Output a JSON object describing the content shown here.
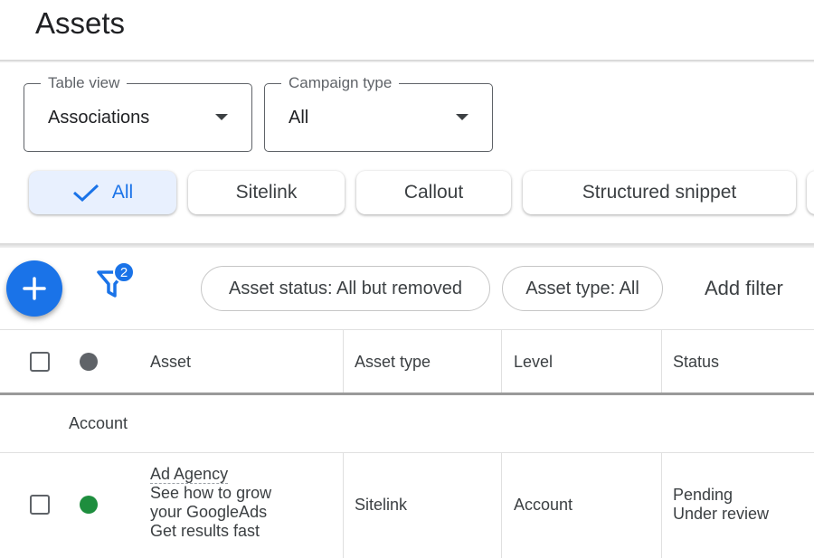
{
  "header": {
    "title": "Assets"
  },
  "filters": {
    "table_view": {
      "label": "Table view",
      "value": "Associations"
    },
    "campaign_type": {
      "label": "Campaign type",
      "value": "All"
    }
  },
  "chips": [
    {
      "label": "All",
      "selected": true
    },
    {
      "label": "Sitelink"
    },
    {
      "label": "Callout"
    },
    {
      "label": "Structured snippet"
    }
  ],
  "toolbar": {
    "filter_count": "2",
    "pills": [
      "Asset status: All but removed",
      "Asset type: All"
    ],
    "add_filter": "Add filter"
  },
  "table": {
    "columns": [
      "Asset",
      "Asset type",
      "Level",
      "Status"
    ],
    "group_label": "Account",
    "rows": [
      {
        "asset_lines": [
          "Ad Agency",
          "See how to grow",
          "your GoogleAds",
          "Get results fast"
        ],
        "asset_type": "Sitelink",
        "level": "Account",
        "status_lines": [
          "Pending",
          "Under review"
        ],
        "status_color": "#1e8e3e"
      }
    ]
  },
  "colors": {
    "accent": "#1a73e8",
    "status_dot_header": "#5f6368",
    "status_dot_enabled": "#1e8e3e"
  }
}
